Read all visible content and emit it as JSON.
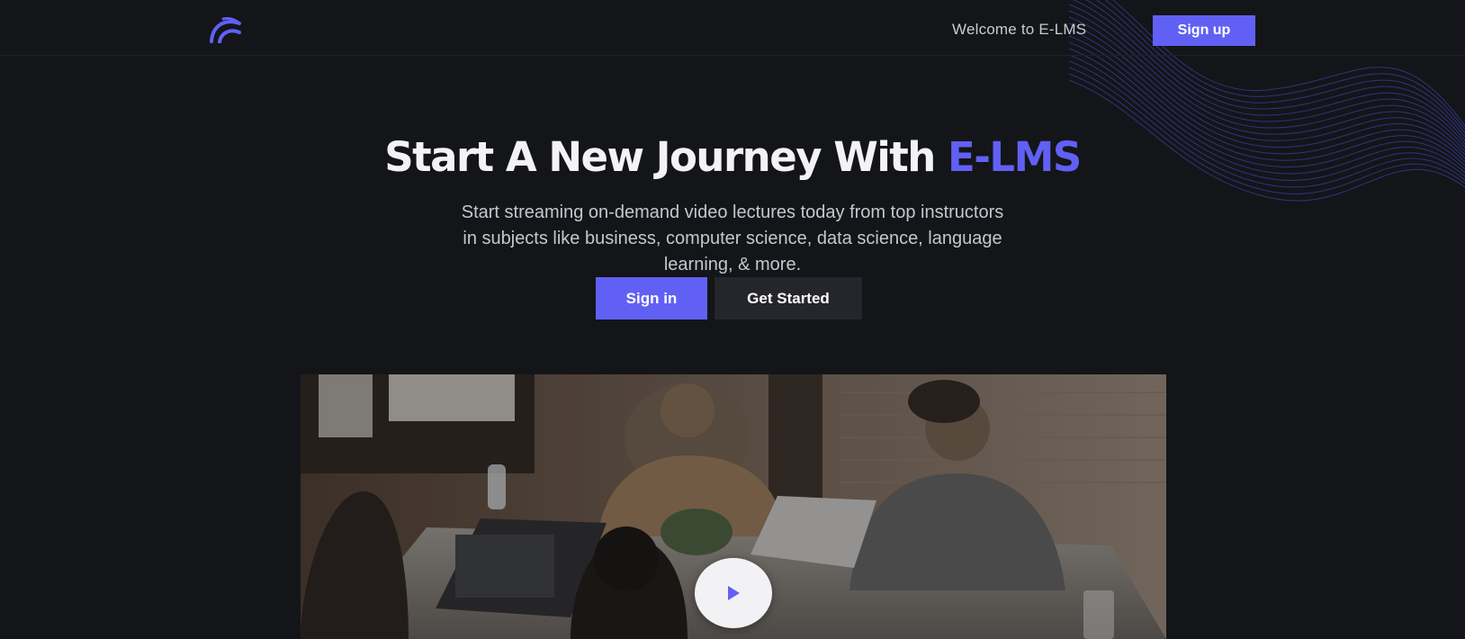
{
  "header": {
    "logo_icon": "e-lms-logo-icon",
    "welcome_text": "Welcome to E-LMS",
    "signup_label": "Sign up"
  },
  "hero": {
    "title_main": "Start A New Journey With",
    "title_accent": "E-LMS",
    "subtitle": "Start streaming on-demand video lectures today from top instructors in subjects like business, computer science, data science, language learning, & more.",
    "signin_label": "Sign in",
    "get_started_label": "Get Started"
  },
  "video": {
    "play_icon": "play-icon"
  },
  "colors": {
    "background": "#141519",
    "accent": "#6160f5",
    "secondary_button": "#25262c",
    "text_primary": "#f3f3f5",
    "text_muted": "#c5c7ce"
  }
}
